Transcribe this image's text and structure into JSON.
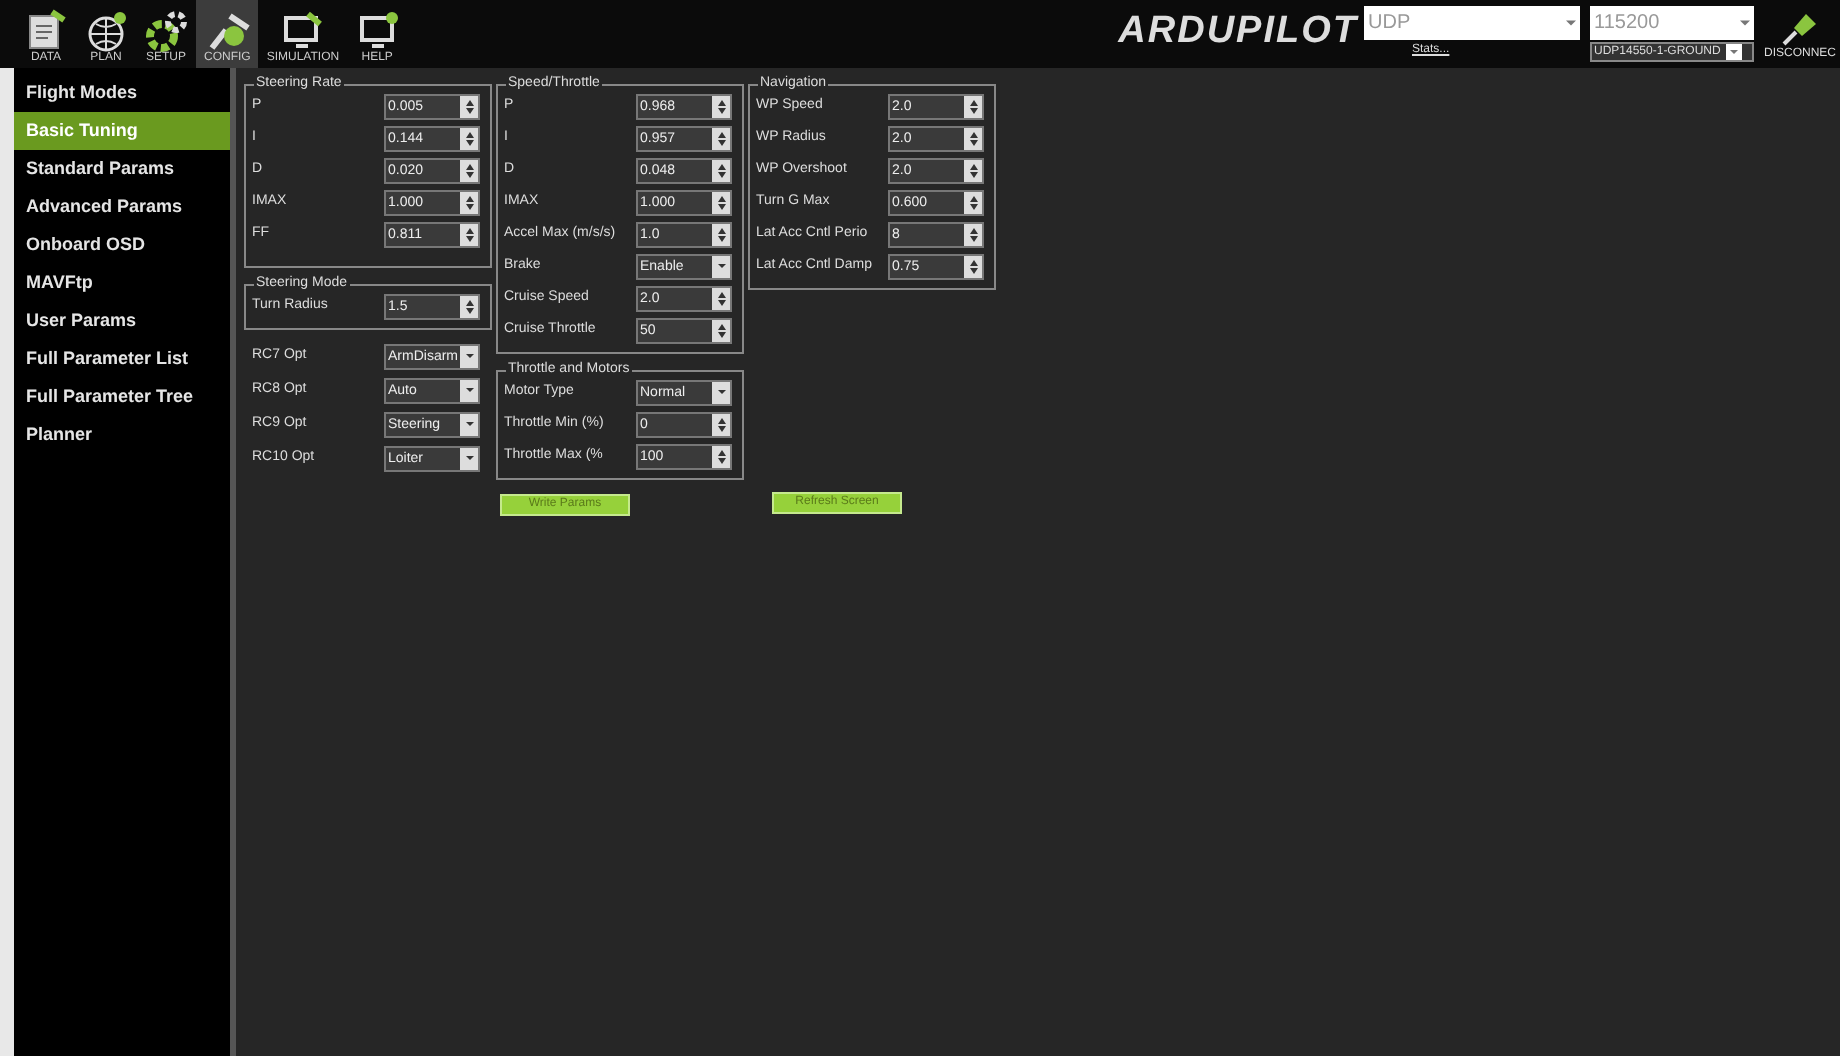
{
  "toolbar": {
    "items": [
      {
        "label": "DATA",
        "selected": false
      },
      {
        "label": "PLAN",
        "selected": false
      },
      {
        "label": "SETUP",
        "selected": false
      },
      {
        "label": "CONFIG",
        "selected": true
      },
      {
        "label": "SIMULATION",
        "selected": false
      },
      {
        "label": "HELP",
        "selected": false
      }
    ]
  },
  "logo": "ARDUPILOT",
  "connection": {
    "port": "UDP",
    "baud": "115200",
    "stats": "Stats...",
    "link": "UDP14550-1-GROUND",
    "connect": "DISCONNEC"
  },
  "sidebar": {
    "items": [
      {
        "label": "Flight Modes",
        "selected": false
      },
      {
        "label": "Basic Tuning",
        "selected": true
      },
      {
        "label": "Standard Params",
        "selected": false
      },
      {
        "label": "Advanced Params",
        "selected": false
      },
      {
        "label": "Onboard OSD",
        "selected": false
      },
      {
        "label": "MAVFtp",
        "selected": false
      },
      {
        "label": "User Params",
        "selected": false
      },
      {
        "label": "Full Parameter List",
        "selected": false
      },
      {
        "label": "Full Parameter Tree",
        "selected": false
      },
      {
        "label": "Planner",
        "selected": false
      }
    ]
  },
  "columns": [
    [
      {
        "kind": "group",
        "title": "Steering Rate",
        "rows": [
          {
            "kind": "spin",
            "label": "P",
            "value": "0.005"
          },
          {
            "kind": "spin",
            "label": "I",
            "value": "0.144"
          },
          {
            "kind": "spin",
            "label": "D",
            "value": "0.020"
          },
          {
            "kind": "spin",
            "label": "IMAX",
            "value": "1.000"
          },
          {
            "kind": "spin",
            "label": "FF",
            "value": "0.811"
          }
        ]
      },
      {
        "kind": "group",
        "title": "Steering Mode",
        "rows": [
          {
            "kind": "spin",
            "label": "Turn Radius",
            "value": "1.5"
          }
        ]
      },
      {
        "kind": "rows",
        "rows": [
          {
            "kind": "combo",
            "label": "RC7 Opt",
            "value": "ArmDisarm"
          },
          {
            "kind": "combo",
            "label": "RC8 Opt",
            "value": "Auto"
          },
          {
            "kind": "combo",
            "label": "RC9 Opt",
            "value": "Steering"
          },
          {
            "kind": "combo",
            "label": "RC10 Opt",
            "value": "Loiter"
          }
        ]
      }
    ],
    [
      {
        "kind": "group",
        "title": "Speed/Throttle",
        "rows": [
          {
            "kind": "spin",
            "label": "P",
            "value": "0.968"
          },
          {
            "kind": "spin",
            "label": "I",
            "value": "0.957"
          },
          {
            "kind": "spin",
            "label": "D",
            "value": "0.048"
          },
          {
            "kind": "spin",
            "label": "IMAX",
            "value": "1.000"
          },
          {
            "kind": "spin",
            "label": "Accel Max (m/s/s)",
            "value": "1.0"
          },
          {
            "kind": "combo",
            "label": "Brake",
            "value": "Enable"
          },
          {
            "kind": "spin",
            "label": "Cruise Speed",
            "value": "2.0"
          },
          {
            "kind": "spin",
            "label": "Cruise Throttle",
            "value": "50"
          }
        ]
      },
      {
        "kind": "group",
        "title": "Throttle and Motors",
        "rows": [
          {
            "kind": "combo",
            "label": "Motor Type",
            "value": "Normal"
          },
          {
            "kind": "spin",
            "label": "Throttle Min (%)",
            "value": "0"
          },
          {
            "kind": "spin",
            "label": "Throttle Max (%",
            "value": "100"
          }
        ]
      },
      {
        "kind": "button",
        "label": "Write Params"
      }
    ],
    [
      {
        "kind": "group",
        "title": "Navigation",
        "rows": [
          {
            "kind": "spin",
            "label": "WP Speed",
            "value": "2.0"
          },
          {
            "kind": "spin",
            "label": "WP Radius",
            "value": "2.0"
          },
          {
            "kind": "spin",
            "label": "WP Overshoot",
            "value": "2.0"
          },
          {
            "kind": "spin",
            "label": "Turn G Max",
            "value": "0.600"
          },
          {
            "kind": "spin",
            "label": "Lat Acc Cntl Perio",
            "value": "8"
          },
          {
            "kind": "spin",
            "label": "Lat Acc Cntl Damp",
            "value": "0.75"
          }
        ]
      },
      {
        "kind": "spacer"
      },
      {
        "kind": "button",
        "label": "Refresh Screen"
      }
    ]
  ]
}
